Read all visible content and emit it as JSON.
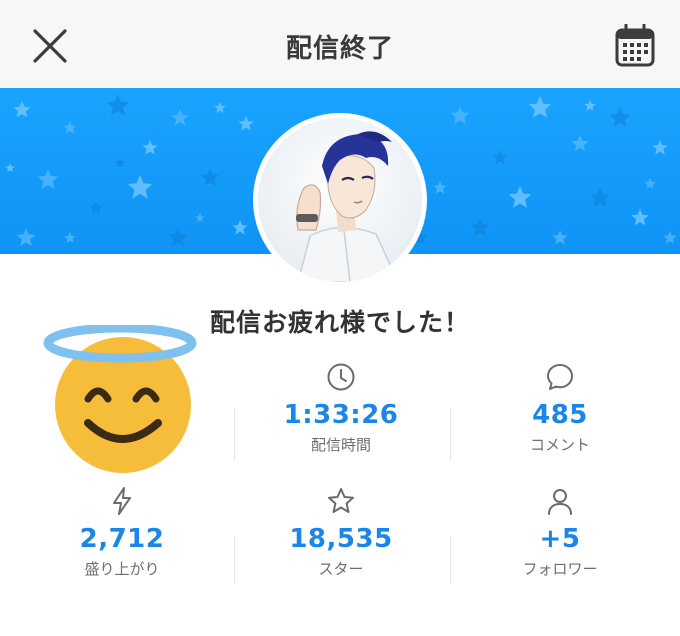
{
  "header": {
    "title": "配信終了",
    "close_icon": "close-icon",
    "calendar_icon": "calendar-icon"
  },
  "banner": {
    "background_color": "#1aa3ff",
    "pattern": "stars"
  },
  "avatar": {
    "kind": "streamer-avatar-illustration"
  },
  "headline": "配信お疲れ様でした！",
  "emoji": "smiling-face-with-halo",
  "stats": [
    {
      "icon": "clock-icon",
      "value": "1:33:26",
      "label": "配信時間"
    },
    {
      "icon": "comment-icon",
      "value": "485",
      "label": "コメント"
    },
    {
      "icon": "lightning-icon",
      "value": "2,712",
      "label": "盛り上がり"
    },
    {
      "icon": "star-icon",
      "value": "18,535",
      "label": "スター"
    },
    {
      "icon": "person-icon",
      "value": "+5",
      "label": "フォロワー"
    }
  ],
  "colors": {
    "accent": "#1a87e8",
    "topbar": "#f7f7f7",
    "banner": "#1aa3ff"
  }
}
